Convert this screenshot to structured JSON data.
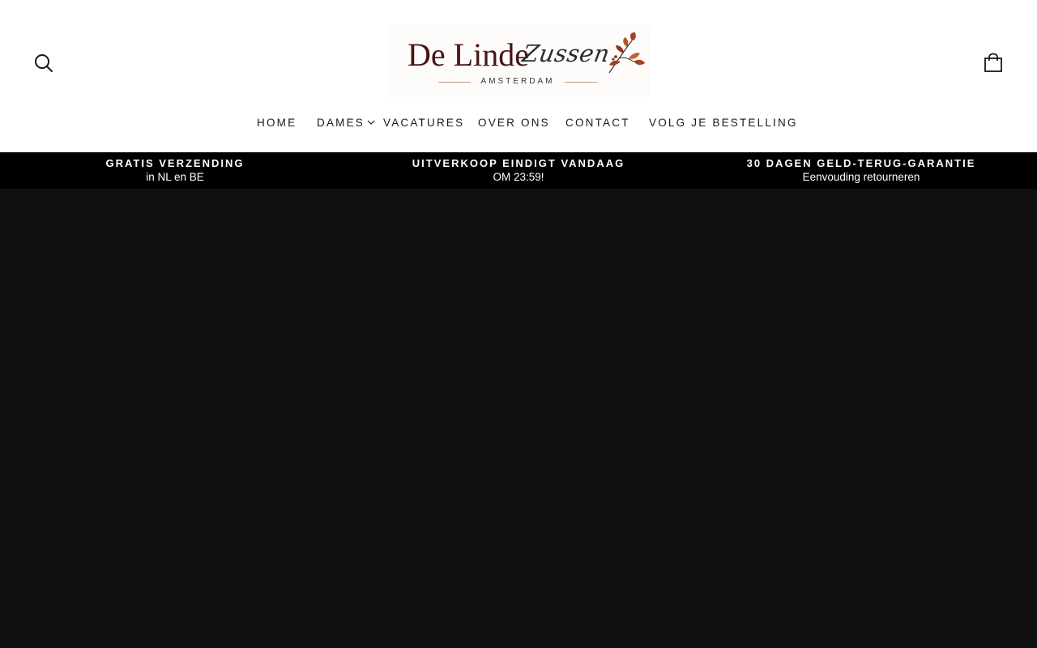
{
  "header": {
    "logo": {
      "main": "De Linde",
      "script": "Zussen",
      "subtitle": "AMSTERDAM"
    },
    "search_icon": "search-icon",
    "cart_icon": "shopping-bag-icon"
  },
  "nav": {
    "items": [
      {
        "label": "HOME"
      },
      {
        "label": "DAMES",
        "has_dropdown": true
      },
      {
        "label": "VACATURES"
      },
      {
        "label": "OVER ONS"
      },
      {
        "label": "CONTACT"
      },
      {
        "label": "VOLG JE BESTELLING"
      }
    ]
  },
  "announcements": [
    {
      "title": "GRATIS VERZENDING",
      "subtitle": "in NL en BE"
    },
    {
      "title": "UITVERKOOP EINDIGT VANDAAG",
      "subtitle": "OM 23:59!"
    },
    {
      "title": "30 DAGEN GELD-TERUG-GARANTIE",
      "subtitle": "Eenvouding retourneren"
    }
  ],
  "colors": {
    "header_bg": "#ffffff",
    "announcement_bg": "#000000",
    "hero_bg": "#0f0f0f",
    "logo_text": "#4a1414",
    "leaf_accent": "#a4411c"
  }
}
